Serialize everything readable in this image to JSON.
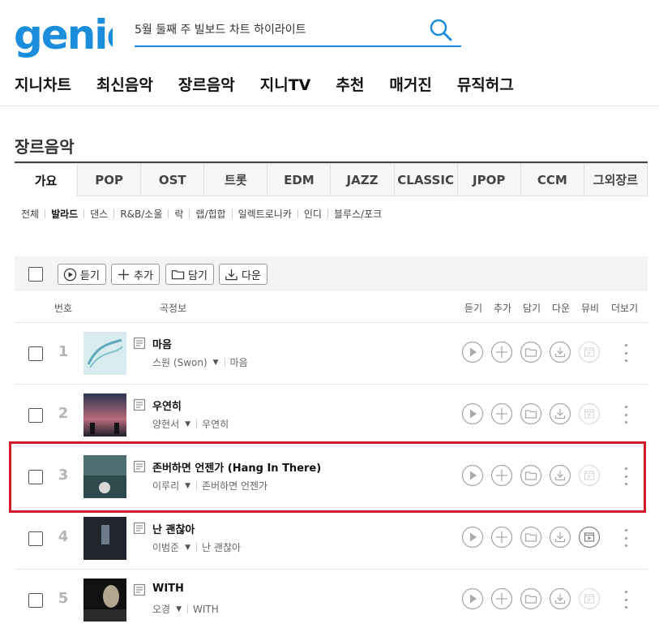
{
  "brand": {
    "logo_text": "genie",
    "logo_color": "#1a8ddd"
  },
  "search": {
    "value": "5월 둘째 주 빌보드 차트 하이라이트",
    "icon": "search-icon"
  },
  "gnb": [
    "지니차트",
    "최신음악",
    "장르음악",
    "지니TV",
    "추천",
    "매거진",
    "뮤직허그"
  ],
  "section_title": "장르음악",
  "genre_tabs": [
    {
      "label": "가요",
      "active": true
    },
    {
      "label": "POP"
    },
    {
      "label": "OST"
    },
    {
      "label": "트롯"
    },
    {
      "label": "EDM"
    },
    {
      "label": "JAZZ"
    },
    {
      "label": "CLASSIC"
    },
    {
      "label": "JPOP"
    },
    {
      "label": "CCM"
    },
    {
      "label": "그외장르"
    }
  ],
  "subgenres": [
    "전체",
    "발라드",
    "댄스",
    "R&B/소울",
    "락",
    "랩/힙합",
    "일렉트로니카",
    "인디",
    "블루스/포크"
  ],
  "subgenre_active": "발라드",
  "toolbar": {
    "play": "듣기",
    "add": "추가",
    "save": "담기",
    "download": "다운"
  },
  "columns": {
    "num": "번호",
    "info": "곡정보",
    "play": "듣기",
    "add": "추가",
    "save": "담기",
    "download": "다운",
    "mv": "뮤비",
    "more": "더보기"
  },
  "songs": [
    {
      "rank": "1",
      "title": "마음",
      "artist": "스원 (Swon)",
      "album": "마음",
      "mv": false
    },
    {
      "rank": "2",
      "title": "우연히",
      "artist": "양현서",
      "album": "우연히",
      "mv": false
    },
    {
      "rank": "3",
      "title": "존버하면 언젠가 (Hang In There)",
      "artist": "이루리",
      "album": "존버하면 언젠가",
      "mv": false
    },
    {
      "rank": "4",
      "title": "난 괜찮아",
      "artist": "이범준",
      "album": "난 괜찮아",
      "mv": true
    },
    {
      "rank": "5",
      "title": "WITH",
      "artist": "오경",
      "album": "WITH",
      "mv": false
    }
  ],
  "colors": {
    "accent": "#1a8ddd",
    "highlight": "#d21c2a"
  }
}
